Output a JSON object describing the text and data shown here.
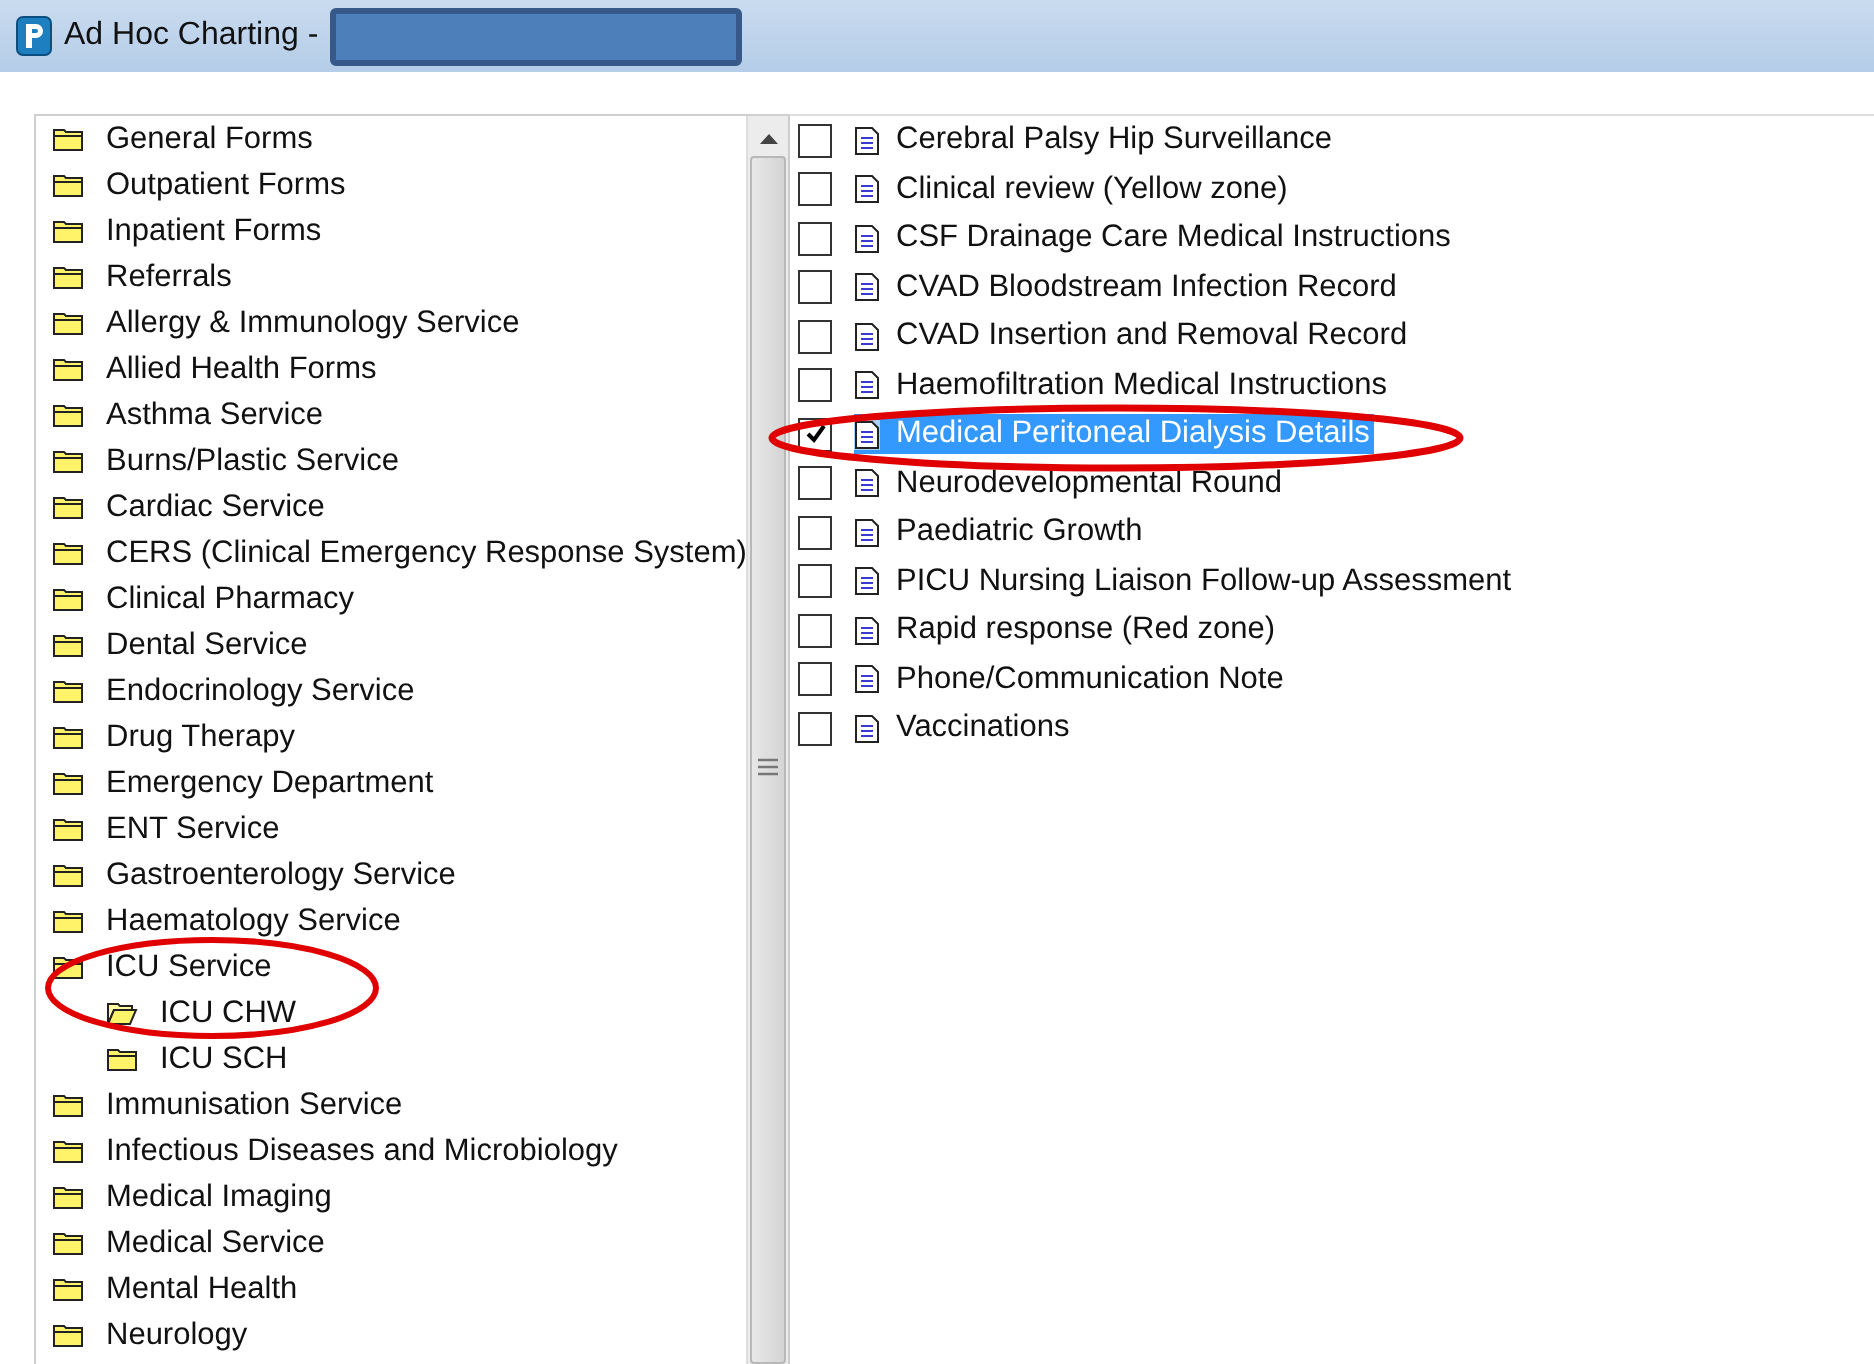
{
  "window": {
    "title": "Ad Hoc Charting -"
  },
  "folders": [
    {
      "label": "General Forms",
      "selected": false
    },
    {
      "label": "Outpatient Forms",
      "selected": false
    },
    {
      "label": "Inpatient Forms",
      "selected": false
    },
    {
      "label": "Referrals",
      "selected": false
    },
    {
      "label": "Allergy & Immunology Service",
      "selected": false
    },
    {
      "label": "Allied Health Forms",
      "selected": false
    },
    {
      "label": "Asthma Service",
      "selected": false
    },
    {
      "label": "Burns/Plastic Service",
      "selected": false
    },
    {
      "label": "Cardiac Service",
      "selected": false
    },
    {
      "label": "CERS (Clinical Emergency Response System)",
      "selected": false
    },
    {
      "label": "Clinical Pharmacy",
      "selected": false
    },
    {
      "label": "Dental Service",
      "selected": false
    },
    {
      "label": "Endocrinology Service",
      "selected": false
    },
    {
      "label": "Drug Therapy",
      "selected": false
    },
    {
      "label": "Emergency Department",
      "selected": false
    },
    {
      "label": "ENT Service",
      "selected": false
    },
    {
      "label": "Gastroenterology Service",
      "selected": false
    },
    {
      "label": "Haematology Service",
      "selected": false
    },
    {
      "label": "ICU Service",
      "selected": false,
      "children": [
        {
          "label": "ICU CHW",
          "selected": true
        },
        {
          "label": "ICU SCH",
          "selected": false
        }
      ]
    },
    {
      "label": "Immunisation Service",
      "selected": false
    },
    {
      "label": "Infectious Diseases and Microbiology",
      "selected": false
    },
    {
      "label": "Medical Imaging",
      "selected": false
    },
    {
      "label": "Medical Service",
      "selected": false
    },
    {
      "label": "Mental Health",
      "selected": false
    },
    {
      "label": "Neurology",
      "selected": false
    }
  ],
  "forms": [
    {
      "label": "Cerebral Palsy Hip Surveillance",
      "checked": false,
      "selected": false
    },
    {
      "label": "Clinical review (Yellow zone)",
      "checked": false,
      "selected": false
    },
    {
      "label": "CSF Drainage Care Medical Instructions",
      "checked": false,
      "selected": false
    },
    {
      "label": "CVAD Bloodstream Infection Record",
      "checked": false,
      "selected": false
    },
    {
      "label": "CVAD Insertion and Removal Record",
      "checked": false,
      "selected": false
    },
    {
      "label": "Haemofiltration Medical Instructions",
      "checked": false,
      "selected": false
    },
    {
      "label": "Medical Peritoneal Dialysis Details",
      "checked": true,
      "selected": true
    },
    {
      "label": "Neurodevelopmental Round",
      "checked": false,
      "selected": false
    },
    {
      "label": "Paediatric Growth",
      "checked": false,
      "selected": false
    },
    {
      "label": "PICU Nursing Liaison Follow-up Assessment",
      "checked": false,
      "selected": false
    },
    {
      "label": "Rapid response (Red zone)",
      "checked": false,
      "selected": false
    },
    {
      "label": "Phone/Communication Note",
      "checked": false,
      "selected": false
    },
    {
      "label": "Vaccinations",
      "checked": false,
      "selected": false
    }
  ]
}
